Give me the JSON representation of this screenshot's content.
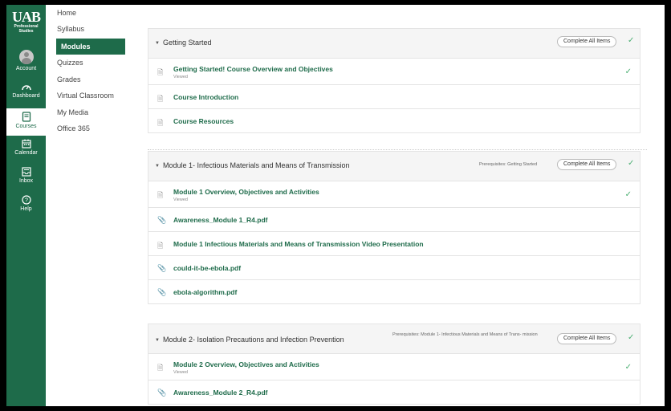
{
  "global_nav": {
    "logo": "UAB",
    "logo_sub": "Professional Studies",
    "items": [
      {
        "label": "Account",
        "icon": "account-avatar-icon"
      },
      {
        "label": "Dashboard",
        "icon": "dashboard-gauge-icon"
      },
      {
        "label": "Courses",
        "icon": "courses-book-icon"
      },
      {
        "label": "Calendar",
        "icon": "calendar-icon"
      },
      {
        "label": "Inbox",
        "icon": "inbox-icon"
      },
      {
        "label": "Help",
        "icon": "help-icon"
      }
    ]
  },
  "course_nav": {
    "items": [
      {
        "label": "Home"
      },
      {
        "label": "Syllabus"
      },
      {
        "label": "Modules"
      },
      {
        "label": "Quizzes"
      },
      {
        "label": "Grades"
      },
      {
        "label": "Virtual Classroom"
      },
      {
        "label": "My Media"
      },
      {
        "label": "Office 365"
      }
    ],
    "active": "Modules"
  },
  "modules": [
    {
      "title": "Getting Started",
      "prereq": "",
      "complete_label": "Complete All Items",
      "completed": true,
      "items": [
        {
          "label": "Getting Started! Course Overview and Objectives",
          "status": "Viewed",
          "type": "page",
          "completed": true
        },
        {
          "label": "Course Introduction",
          "status": "",
          "type": "page",
          "completed": false
        },
        {
          "label": "Course Resources",
          "status": "",
          "type": "page",
          "completed": false
        }
      ]
    },
    {
      "title": "Module 1- Infectious Materials and Means of Transmission",
      "prereq": "Prerequisites: Getting Started",
      "complete_label": "Complete All Items",
      "completed": true,
      "items": [
        {
          "label": "Module 1 Overview, Objectives and Activities",
          "status": "Viewed",
          "type": "page",
          "completed": true
        },
        {
          "label": "Awareness_Module 1_R4.pdf",
          "status": "",
          "type": "attachment",
          "completed": false
        },
        {
          "label": "Module 1 Infectious Materials and Means of Transmission Video Presentation",
          "status": "",
          "type": "page",
          "completed": false
        },
        {
          "label": "could-it-be-ebola.pdf",
          "status": "",
          "type": "attachment",
          "completed": false
        },
        {
          "label": "ebola-algorithm.pdf",
          "status": "",
          "type": "attachment",
          "completed": false
        }
      ]
    },
    {
      "title": "Module 2- Isolation Precautions and Infection Prevention",
      "prereq": "Prerequisites: Module 1- Infectious Materials and Means of Trans- mission",
      "complete_label": "Complete All Items",
      "completed": true,
      "items": [
        {
          "label": "Module 2 Overview, Objectives and Activities",
          "status": "Viewed",
          "type": "page",
          "completed": true
        },
        {
          "label": "Awareness_Module 2_R4.pdf",
          "status": "",
          "type": "attachment",
          "completed": false
        }
      ]
    }
  ],
  "colors": {
    "brand": "#1e6b4a",
    "check": "#4caf73"
  }
}
